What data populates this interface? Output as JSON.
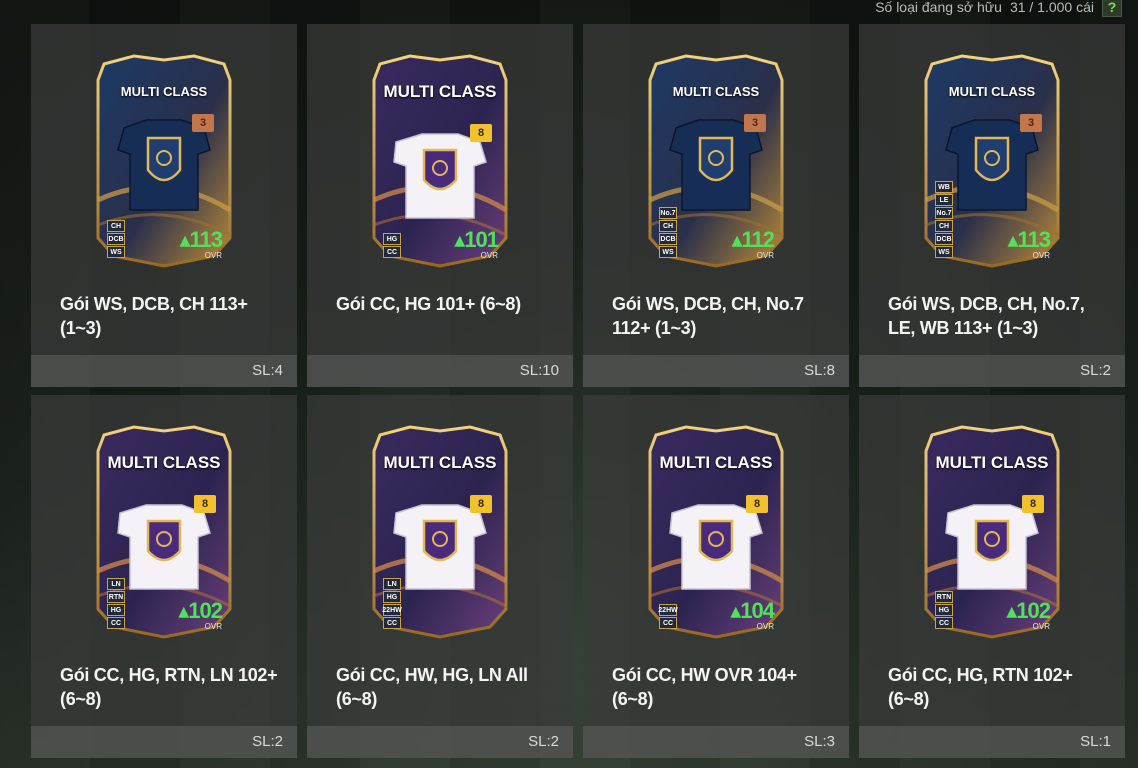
{
  "header": {
    "owned_label": "Số loại đang sở hữu",
    "owned_count": "31 / 1.000 cái",
    "help_symbol": "?"
  },
  "card_common": {
    "title": "MULTI CLASS",
    "ovr_label": "OVR"
  },
  "colors": {
    "ovr_green": "#4ee35a",
    "panel_bg": "#3a3c3a",
    "help_green": "#7ee04a"
  },
  "packs": [
    {
      "name": "Gói WS, DCB, CH 113+ (1~3)",
      "qty": "SL:4",
      "ovr": "113",
      "grade": "3",
      "style": "dark",
      "positions": [
        "CH",
        "DCB",
        "WS"
      ]
    },
    {
      "name": "Gói CC, HG 101+ (6~8)",
      "qty": "SL:10",
      "ovr": "101",
      "grade": "8",
      "style": "white",
      "positions": [
        "HG",
        "CC"
      ]
    },
    {
      "name": "Gói WS, DCB, CH, No.7 112+ (1~3)",
      "qty": "SL:8",
      "ovr": "112",
      "grade": "3",
      "style": "dark",
      "positions": [
        "No.7",
        "CH",
        "DCB",
        "WS"
      ]
    },
    {
      "name": "Gói WS, DCB, CH, No.7, LE, WB 113+ (1~3)",
      "qty": "SL:2",
      "ovr": "113",
      "grade": "3",
      "style": "dark",
      "positions": [
        "WB",
        "LE",
        "No.7",
        "CH",
        "DCB",
        "WS"
      ]
    },
    {
      "name": "Gói CC, HG, RTN, LN 102+ (6~8)",
      "qty": "SL:2",
      "ovr": "102",
      "grade": "8",
      "style": "white",
      "positions": [
        "LN",
        "RTN",
        "HG",
        "CC"
      ]
    },
    {
      "name": "Gói CC, HW, HG, LN All (6~8)",
      "qty": "SL:2",
      "ovr": "",
      "grade": "8",
      "style": "white",
      "positions": [
        "LN",
        "HG",
        "22HW",
        "CC"
      ]
    },
    {
      "name": "Gói CC, HW OVR 104+ (6~8)",
      "qty": "SL:3",
      "ovr": "104",
      "grade": "8",
      "style": "white",
      "positions": [
        "22HW",
        "CC"
      ]
    },
    {
      "name": "Gói CC, HG, RTN 102+ (6~8)",
      "qty": "SL:1",
      "ovr": "102",
      "grade": "8",
      "style": "white",
      "positions": [
        "RTN",
        "HG",
        "CC"
      ]
    }
  ]
}
